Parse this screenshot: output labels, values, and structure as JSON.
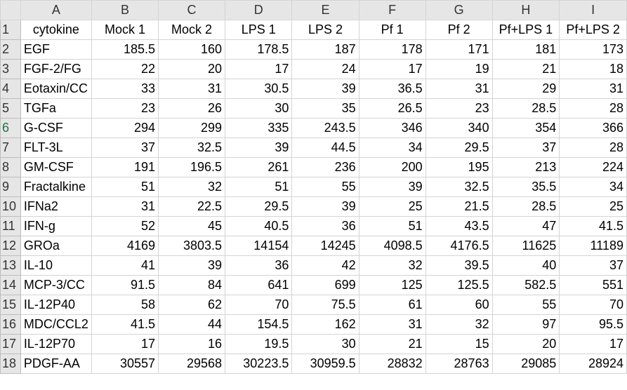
{
  "columns": [
    "A",
    "B",
    "C",
    "D",
    "E",
    "F",
    "G",
    "H",
    "I"
  ],
  "header_row": {
    "row_number": "1",
    "cells": [
      "cytokine",
      "Mock 1",
      "Mock 2",
      "LPS 1",
      "LPS 2",
      "Pf 1",
      "Pf 2",
      "Pf+LPS 1",
      "Pf+LPS 2"
    ]
  },
  "rows": [
    {
      "row_number": "2",
      "cells": [
        "EGF",
        "185.5",
        "160",
        "178.5",
        "187",
        "178",
        "171",
        "181",
        "173"
      ]
    },
    {
      "row_number": "3",
      "cells": [
        "FGF-2/FG",
        "22",
        "20",
        "17",
        "24",
        "17",
        "19",
        "21",
        "18"
      ]
    },
    {
      "row_number": "4",
      "cells": [
        "Eotaxin/CC",
        "33",
        "31",
        "30.5",
        "39",
        "36.5",
        "31",
        "29",
        "31"
      ]
    },
    {
      "row_number": "5",
      "cells": [
        "TGFa",
        "23",
        "26",
        "30",
        "35",
        "26.5",
        "23",
        "28.5",
        "28"
      ]
    },
    {
      "row_number": "6",
      "cells": [
        "G-CSF",
        "294",
        "299",
        "335",
        "243.5",
        "346",
        "340",
        "354",
        "366"
      ]
    },
    {
      "row_number": "7",
      "cells": [
        "FLT-3L",
        "37",
        "32.5",
        "39",
        "44.5",
        "34",
        "29.5",
        "37",
        "28"
      ]
    },
    {
      "row_number": "8",
      "cells": [
        "GM-CSF",
        "191",
        "196.5",
        "261",
        "236",
        "200",
        "195",
        "213",
        "224"
      ]
    },
    {
      "row_number": "9",
      "cells": [
        "Fractalkine",
        "51",
        "32",
        "51",
        "55",
        "39",
        "32.5",
        "35.5",
        "34"
      ]
    },
    {
      "row_number": "10",
      "cells": [
        "IFNa2",
        "31",
        "22.5",
        "29.5",
        "39",
        "25",
        "21.5",
        "28.5",
        "25"
      ]
    },
    {
      "row_number": "11",
      "cells": [
        "IFN-g",
        "52",
        "45",
        "40.5",
        "36",
        "51",
        "43.5",
        "47",
        "41.5"
      ]
    },
    {
      "row_number": "12",
      "cells": [
        "GROa",
        "4169",
        "3803.5",
        "14154",
        "14245",
        "4098.5",
        "4176.5",
        "11625",
        "11189"
      ]
    },
    {
      "row_number": "13",
      "cells": [
        "IL-10",
        "41",
        "39",
        "36",
        "42",
        "32",
        "39.5",
        "40",
        "37"
      ]
    },
    {
      "row_number": "14",
      "cells": [
        "MCP-3/CC",
        "91.5",
        "84",
        "641",
        "699",
        "125",
        "125.5",
        "582.5",
        "551"
      ]
    },
    {
      "row_number": "15",
      "cells": [
        "IL-12P40",
        "58",
        "62",
        "70",
        "75.5",
        "61",
        "60",
        "55",
        "70"
      ]
    },
    {
      "row_number": "16",
      "cells": [
        "MDC/CCL2",
        "41.5",
        "44",
        "154.5",
        "162",
        "31",
        "32",
        "97",
        "95.5"
      ]
    },
    {
      "row_number": "17",
      "cells": [
        "IL-12P70",
        "17",
        "16",
        "19.5",
        "30",
        "21",
        "15",
        "20",
        "17"
      ]
    },
    {
      "row_number": "18",
      "cells": [
        "PDGF-AA",
        "30557",
        "29568",
        "30223.5",
        "30959.5",
        "28832",
        "28763",
        "29085",
        "28924"
      ]
    }
  ],
  "active_row": "6",
  "accent_color": "#217346"
}
